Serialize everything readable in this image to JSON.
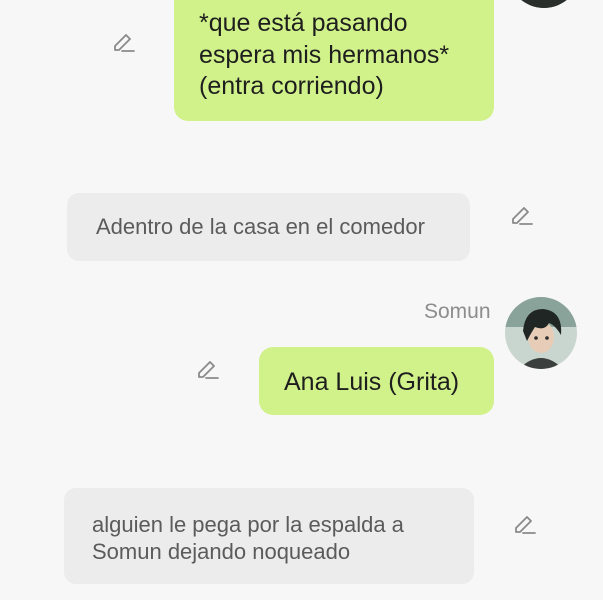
{
  "colors": {
    "background": "#f7f7f7",
    "user_bubble": "#d1f28a",
    "narration_bubble": "#ececec",
    "icon": "#8a8a8a"
  },
  "messages": [
    {
      "type": "user",
      "text": "*que está pasando\nespera mis hermanos*\n(entra corriendo)",
      "edit_icon": "edit-pencil-icon"
    },
    {
      "type": "narration",
      "text": "Adentro de la casa en el comedor",
      "edit_icon": "edit-pencil-icon"
    },
    {
      "type": "character",
      "sender": "Somun",
      "text": "Ana Luis (Grita)",
      "avatar": "character-avatar",
      "edit_icon": "edit-pencil-icon"
    },
    {
      "type": "narration",
      "text": "alguien le pega por la espalda a\nSomun dejando noqueado",
      "edit_icon": "edit-pencil-icon"
    }
  ]
}
